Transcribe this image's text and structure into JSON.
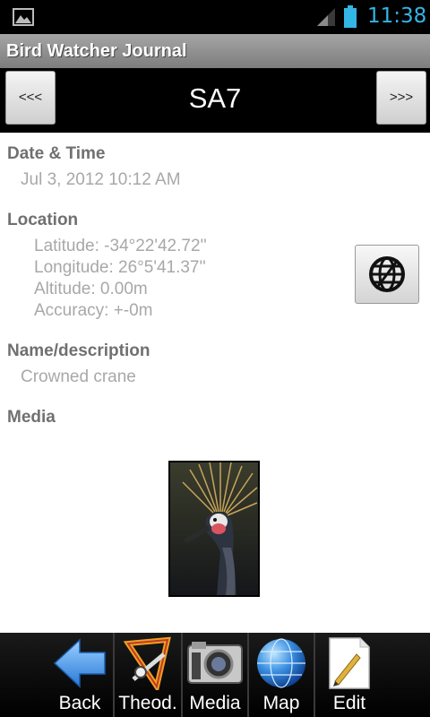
{
  "status_bar": {
    "time": "11:38"
  },
  "app": {
    "title": "Bird Watcher Journal"
  },
  "header": {
    "prev_label": "<<<",
    "record_name": "SA7",
    "next_label": ">>>"
  },
  "datetime": {
    "label": "Date & Time",
    "value": "Jul 3, 2012 10:12 AM"
  },
  "location": {
    "label": "Location",
    "latitude": "Latitude: -34°22'42.72''",
    "longitude": "Longitude: 26°5'41.37''",
    "altitude": "Altitude: 0.00m",
    "accuracy": "Accuracy: +-0m"
  },
  "description": {
    "label": "Name/description",
    "value": "Crowned crane"
  },
  "media": {
    "label": "Media"
  },
  "toolbar": {
    "items": [
      {
        "label": "Back",
        "icon": "back-arrow-icon"
      },
      {
        "label": "Theod.",
        "icon": "theodolite-icon"
      },
      {
        "label": "Media",
        "icon": "camera-icon"
      },
      {
        "label": "Map",
        "icon": "globe-icon"
      },
      {
        "label": "Edit",
        "icon": "pencil-icon"
      }
    ]
  },
  "colors": {
    "status_time": "#33b5e5",
    "label": "#707070",
    "value": "#a8a8a8"
  }
}
